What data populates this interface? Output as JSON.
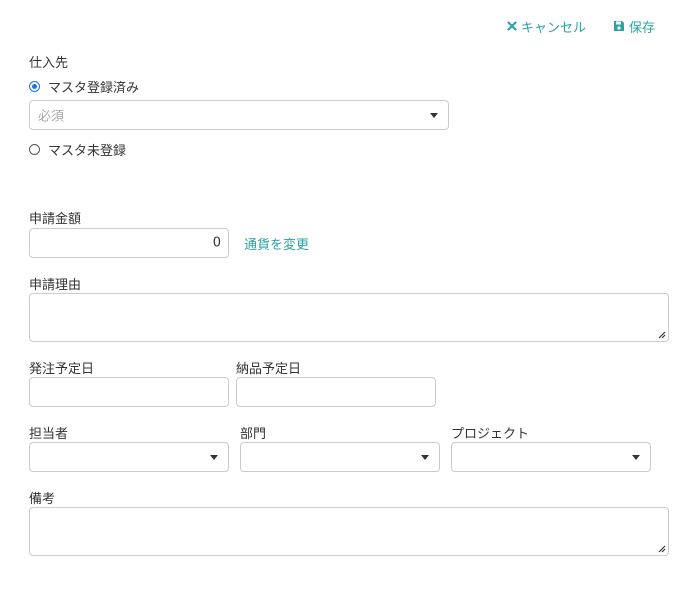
{
  "toolbar": {
    "cancel_label": "キャンセル",
    "save_label": "保存",
    "accent_color": "#2aa3a3"
  },
  "supplier": {
    "label": "仕入先",
    "option_registered": "マスタ登録済み",
    "option_unregistered": "マスタ未登録",
    "select_placeholder": "必須",
    "selected_option": "registered"
  },
  "amount": {
    "label": "申請金額",
    "value": "0",
    "change_currency_link": "通貨を変更"
  },
  "reason": {
    "label": "申請理由",
    "value": ""
  },
  "order_date": {
    "label": "発注予定日",
    "value": ""
  },
  "delivery_date": {
    "label": "納品予定日",
    "value": ""
  },
  "assignee": {
    "label": "担当者",
    "value": ""
  },
  "department": {
    "label": "部門",
    "value": ""
  },
  "project": {
    "label": "プロジェクト",
    "value": ""
  },
  "notes": {
    "label": "備考",
    "value": ""
  }
}
